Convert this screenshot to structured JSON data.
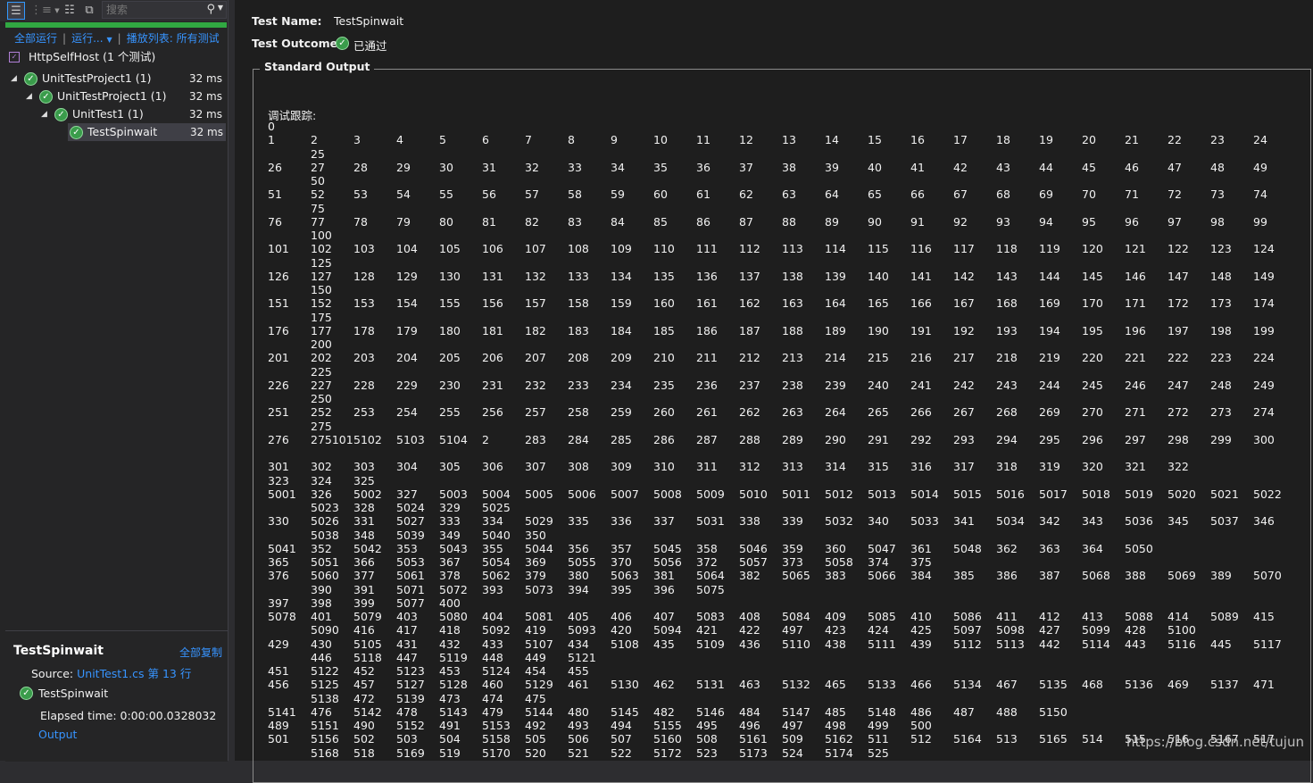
{
  "toolbar": {
    "search_placeholder": "搜索",
    "buttons": [
      "group-by-icon",
      "hierarchy-icon",
      "playlist-icon",
      "window-icon"
    ]
  },
  "run_bar": {
    "run_all": "全部运行",
    "run": "运行...",
    "playlist": "播放列表: 所有测试"
  },
  "tree": {
    "root": "HttpSelfHost (1 个测试)",
    "rows": [
      {
        "name": "UnitTestProject1 (1)",
        "time": "32 ms"
      },
      {
        "name": "UnitTestProject1 (1)",
        "time": "32 ms"
      },
      {
        "name": "UnitTest1 (1)",
        "time": "32 ms"
      },
      {
        "name": "TestSpinwait",
        "time": "32 ms"
      }
    ]
  },
  "detail": {
    "title": "TestSpinwait",
    "copy_all": "全部复制",
    "source_label": "Source:",
    "source_link": "UnitTest1.cs 第 13 行",
    "test_name": "TestSpinwait",
    "elapsed": "Elapsed time: 0:00:00.0328032",
    "output_link": "Output"
  },
  "result": {
    "name_label": "Test Name:",
    "name_value": "TestSpinwait",
    "outcome_label": "Test Outcome:",
    "outcome_value": "已通过",
    "std_output_title": "Standard Output",
    "trace_label": "调试跟踪:"
  },
  "colors": {
    "pass_green": "#3a9c4b",
    "link_blue": "#3794ff",
    "progress_green": "#31a842"
  },
  "output_lines": [
    [
      "0"
    ],
    [
      "1",
      "2",
      "3",
      "4",
      "5",
      "6",
      "7",
      "8",
      "9",
      "10",
      "11",
      "12",
      "13",
      "14",
      "15",
      "16",
      "17",
      "18",
      "19",
      "20",
      "21",
      "22",
      "23",
      "24"
    ],
    [
      "",
      "25"
    ],
    [
      "26",
      "27",
      "28",
      "29",
      "30",
      "31",
      "32",
      "33",
      "34",
      "35",
      "36",
      "37",
      "38",
      "39",
      "40",
      "41",
      "42",
      "43",
      "44",
      "45",
      "46",
      "47",
      "48",
      "49"
    ],
    [
      "",
      "50"
    ],
    [
      "51",
      "52",
      "53",
      "54",
      "55",
      "56",
      "57",
      "58",
      "59",
      "60",
      "61",
      "62",
      "63",
      "64",
      "65",
      "66",
      "67",
      "68",
      "69",
      "70",
      "71",
      "72",
      "73",
      "74"
    ],
    [
      "",
      "75"
    ],
    [
      "76",
      "77",
      "78",
      "79",
      "80",
      "81",
      "82",
      "83",
      "84",
      "85",
      "86",
      "87",
      "88",
      "89",
      "90",
      "91",
      "92",
      "93",
      "94",
      "95",
      "96",
      "97",
      "98",
      "99"
    ],
    [
      "",
      "100"
    ],
    [
      "101",
      "102",
      "103",
      "104",
      "105",
      "106",
      "107",
      "108",
      "109",
      "110",
      "111",
      "112",
      "113",
      "114",
      "115",
      "116",
      "117",
      "118",
      "119",
      "120",
      "121",
      "122",
      "123",
      "124"
    ],
    [
      "",
      "125"
    ],
    [
      "126",
      "127",
      "128",
      "129",
      "130",
      "131",
      "132",
      "133",
      "134",
      "135",
      "136",
      "137",
      "138",
      "139",
      "140",
      "141",
      "142",
      "143",
      "144",
      "145",
      "146",
      "147",
      "148",
      "149"
    ],
    [
      "",
      "150"
    ],
    [
      "151",
      "152",
      "153",
      "154",
      "155",
      "156",
      "157",
      "158",
      "159",
      "160",
      "161",
      "162",
      "163",
      "164",
      "165",
      "166",
      "167",
      "168",
      "169",
      "170",
      "171",
      "172",
      "173",
      "174"
    ],
    [
      "",
      "175"
    ],
    [
      "176",
      "177",
      "178",
      "179",
      "180",
      "181",
      "182",
      "183",
      "184",
      "185",
      "186",
      "187",
      "188",
      "189",
      "190",
      "191",
      "192",
      "193",
      "194",
      "195",
      "196",
      "197",
      "198",
      "199"
    ],
    [
      "",
      "200"
    ],
    [
      "201",
      "202",
      "203",
      "204",
      "205",
      "206",
      "207",
      "208",
      "209",
      "210",
      "211",
      "212",
      "213",
      "214",
      "215",
      "216",
      "217",
      "218",
      "219",
      "220",
      "221",
      "222",
      "223",
      "224"
    ],
    [
      "",
      "225"
    ],
    [
      "226",
      "227",
      "228",
      "229",
      "230",
      "231",
      "232",
      "233",
      "234",
      "235",
      "236",
      "237",
      "238",
      "239",
      "240",
      "241",
      "242",
      "243",
      "244",
      "245",
      "246",
      "247",
      "248",
      "249"
    ],
    [
      "",
      "250"
    ],
    [
      "251",
      "252",
      "253",
      "254",
      "255",
      "256",
      "257",
      "258",
      "259",
      "260",
      "261",
      "262",
      "263",
      "264",
      "265",
      "266",
      "267",
      "268",
      "269",
      "270",
      "271",
      "272",
      "273",
      "274"
    ],
    [
      "",
      "275"
    ],
    [
      "276",
      "275101",
      "5102",
      "5103",
      "5104",
      "2",
      "283",
      "284",
      "285",
      "286",
      "287",
      "288",
      "289",
      "290",
      "291",
      "292",
      "293",
      "294",
      "295",
      "296",
      "297",
      "298",
      "299",
      "300"
    ],
    [],
    [
      "301",
      "302",
      "303",
      "304",
      "305",
      "306",
      "307",
      "308",
      "309",
      "310",
      "311",
      "312",
      "313",
      "314",
      "315",
      "316",
      "317",
      "318",
      "319",
      "320",
      "321",
      "322"
    ],
    [
      "323",
      "324",
      "325"
    ],
    [
      "5001",
      "326",
      "5002",
      "327",
      "5003",
      "5004",
      "5005",
      "5006",
      "5007",
      "5008",
      "5009",
      "5010",
      "5011",
      "5012",
      "5013",
      "5014",
      "5015",
      "5016",
      "5017",
      "5018",
      "5019",
      "5020",
      "5021",
      "5022"
    ],
    [
      "",
      "5023",
      "328",
      "5024",
      "329",
      "5025"
    ],
    [
      "330",
      "5026",
      "331",
      "5027",
      "333",
      "334",
      "5029",
      "335",
      "336",
      "337",
      "5031",
      "338",
      "339",
      "5032",
      "340",
      "5033",
      "341",
      "5034",
      "342",
      "343",
      "5036",
      "345",
      "5037",
      "346"
    ],
    [
      "",
      "5038",
      "348",
      "5039",
      "349",
      "5040",
      "350"
    ],
    [
      "5041",
      "352",
      "5042",
      "353",
      "5043",
      "355",
      "5044",
      "356",
      "357",
      "5045",
      "358",
      "5046",
      "359",
      "360",
      "5047",
      "361",
      "5048",
      "362",
      "363",
      "364",
      "5050"
    ],
    [
      "365",
      "5051",
      "366",
      "5053",
      "367",
      "5054",
      "369",
      "5055",
      "370",
      "5056",
      "372",
      "5057",
      "373",
      "5058",
      "374",
      "375"
    ],
    [
      "376",
      "5060",
      "377",
      "5061",
      "378",
      "5062",
      "379",
      "380",
      "5063",
      "381",
      "5064",
      "382",
      "5065",
      "383",
      "5066",
      "384",
      "385",
      "386",
      "387",
      "5068",
      "388",
      "5069",
      "389",
      "5070"
    ],
    [
      "",
      "390",
      "391",
      "5071",
      "5072",
      "393",
      "5073",
      "394",
      "395",
      "396",
      "5075"
    ],
    [
      "397",
      "398",
      "399",
      "5077",
      "400"
    ],
    [
      "5078",
      "401",
      "5079",
      "403",
      "5080",
      "404",
      "5081",
      "405",
      "406",
      "407",
      "5083",
      "408",
      "5084",
      "409",
      "5085",
      "410",
      "5086",
      "411",
      "412",
      "413",
      "5088",
      "414",
      "5089",
      "415"
    ],
    [
      "",
      "5090",
      "416",
      "417",
      "418",
      "5092",
      "419",
      "5093",
      "420",
      "5094",
      "421",
      "422",
      "497",
      "423",
      "424",
      "425",
      "5097",
      "5098",
      "427",
      "5099",
      "428",
      "5100"
    ],
    [
      "429",
      "430",
      "5105",
      "431",
      "432",
      "433",
      "5107",
      "434",
      "5108",
      "435",
      "5109",
      "436",
      "5110",
      "438",
      "5111",
      "439",
      "5112",
      "5113",
      "442",
      "5114",
      "443",
      "5116",
      "445",
      "5117"
    ],
    [
      "",
      "446",
      "5118",
      "447",
      "5119",
      "448",
      "449",
      "5121"
    ],
    [
      "451",
      "5122",
      "452",
      "5123",
      "453",
      "5124",
      "454",
      "455"
    ],
    [
      "456",
      "5125",
      "457",
      "5127",
      "5128",
      "460",
      "5129",
      "461",
      "5130",
      "462",
      "5131",
      "463",
      "5132",
      "465",
      "5133",
      "466",
      "5134",
      "467",
      "5135",
      "468",
      "5136",
      "469",
      "5137",
      "471"
    ],
    [
      "",
      "5138",
      "472",
      "5139",
      "473",
      "474",
      "475"
    ],
    [
      "5141",
      "476",
      "5142",
      "478",
      "5143",
      "479",
      "5144",
      "480",
      "5145",
      "482",
      "5146",
      "484",
      "5147",
      "485",
      "5148",
      "486",
      "487",
      "488",
      "5150"
    ],
    [
      "489",
      "5151",
      "490",
      "5152",
      "491",
      "5153",
      "492",
      "493",
      "494",
      "5155",
      "495",
      "496",
      "497",
      "498",
      "499",
      "500"
    ],
    [
      "501",
      "5156",
      "502",
      "503",
      "504",
      "5158",
      "505",
      "506",
      "507",
      "5160",
      "508",
      "5161",
      "509",
      "5162",
      "511",
      "512",
      "5164",
      "513",
      "5165",
      "514",
      "515",
      "516",
      "5167",
      "517"
    ],
    [
      "",
      "5168",
      "518",
      "5169",
      "519",
      "5170",
      "520",
      "521",
      "522",
      "5172",
      "523",
      "5173",
      "524",
      "5174",
      "525"
    ]
  ],
  "watermark": "https://blog.csdn.net/tujun"
}
